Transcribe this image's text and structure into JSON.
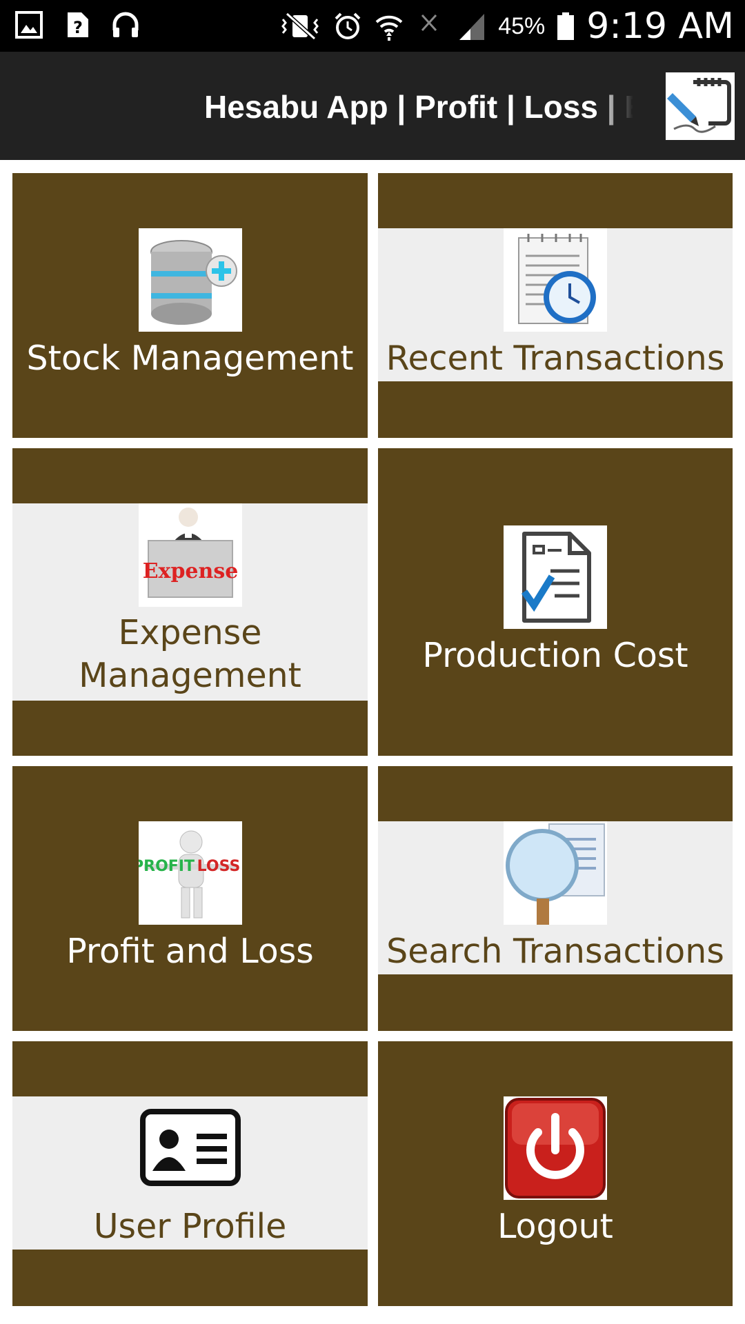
{
  "status_bar": {
    "battery": "45%",
    "time": "9:19 AM",
    "left_icons": [
      "gallery-icon",
      "unknown-file-icon",
      "headphones-icon"
    ],
    "right_icons": [
      "vibrate-icon",
      "alarm-icon",
      "wifi-icon",
      "no-signal-icon",
      "cellular-icon",
      "battery-icon"
    ]
  },
  "app_bar": {
    "title": "Hesabu App | Profit | Loss | Expense",
    "logo_icon": "signature-pen-icon"
  },
  "colors": {
    "tile_dark": "#5a4519",
    "tile_band": "#eeeeee",
    "app_bar": "#222222",
    "status_bar": "#000000"
  },
  "menu": [
    {
      "label": "Stock Management",
      "icon": "database-add-icon",
      "style": "dark"
    },
    {
      "label": "Recent Transactions",
      "icon": "notepad-clock-icon",
      "style": "light"
    },
    {
      "label": "Expense Management",
      "icon": "expense-person-icon",
      "style": "light"
    },
    {
      "label": "Production Cost",
      "icon": "checklist-document-icon",
      "style": "dark"
    },
    {
      "label": "Profit and Loss",
      "icon": "profit-loss-scale-icon",
      "style": "dark"
    },
    {
      "label": "Search Transactions",
      "icon": "magnifier-document-icon",
      "style": "light"
    },
    {
      "label": "User Profile",
      "icon": "id-card-icon",
      "style": "light"
    },
    {
      "label": "Logout",
      "icon": "power-icon",
      "style": "dark"
    }
  ]
}
